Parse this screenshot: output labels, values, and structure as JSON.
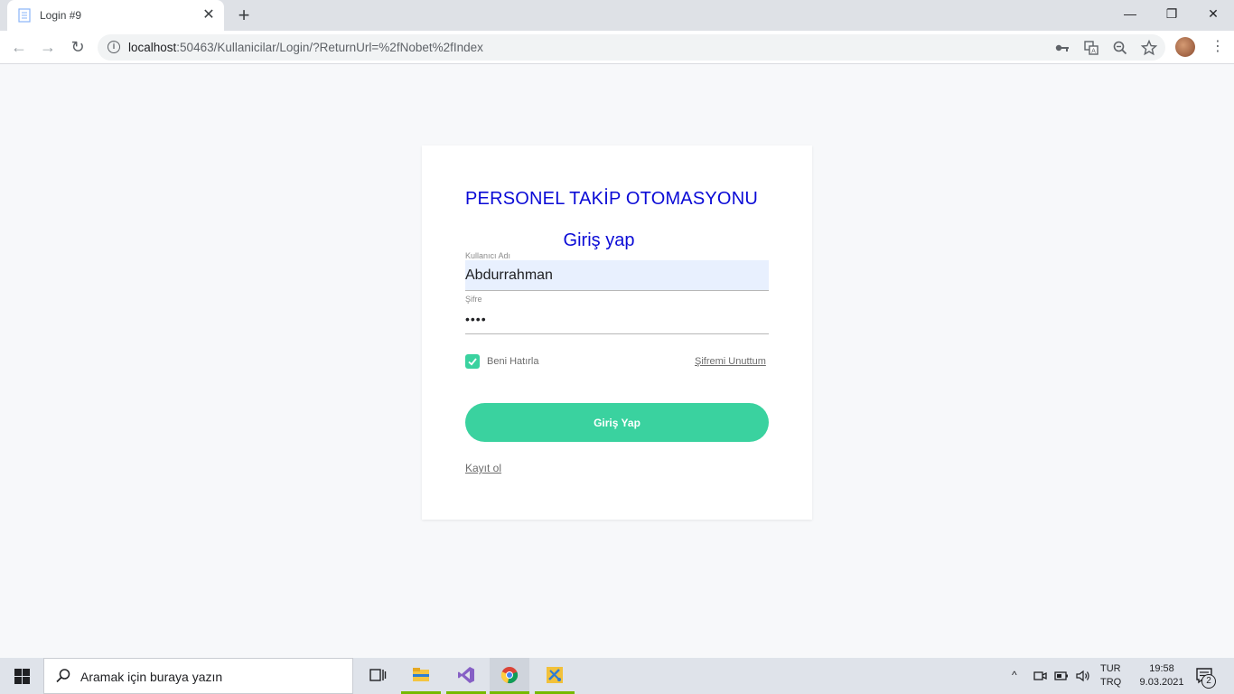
{
  "browser": {
    "tab_title": "Login #9",
    "tab_close": "✕",
    "new_tab": "+",
    "url_host": "localhost",
    "url_rest": ":50463/Kullanicilar/Login/?ReturnUrl=%2fNobet%2fIndex",
    "window_controls": {
      "minimize": "—",
      "maximize": "❐",
      "close": "✕"
    },
    "icons": [
      "back-icon",
      "forward-icon",
      "reload-icon",
      "info-icon",
      "key-icon",
      "translate-icon",
      "zoom-icon",
      "star-icon",
      "profile-avatar",
      "menu-icon"
    ]
  },
  "page": {
    "app_title": "PERSONEL TAKİP OTOMASYONU",
    "login_title": "Giriş yap",
    "username": {
      "label": "Kullanıcı Adı",
      "value": "Abdurrahman"
    },
    "password": {
      "label": "Şifre",
      "value": "••••"
    },
    "remember": {
      "label": "Beni Hatırla",
      "checked": true
    },
    "forgot_label": "Şifremi Unuttum",
    "submit_label": "Giriş Yap",
    "register_label": "Kayıt ol"
  },
  "colors": {
    "title_blue": "#0a0ad6",
    "accent_green": "#3ad29f",
    "page_bg": "#f7f8fa",
    "autofill_bg": "#e8f0fe"
  },
  "taskbar": {
    "search_placeholder": "Aramak için buraya yazın",
    "apps": [
      "task-view-icon",
      "file-explorer-icon",
      "visual-studio-icon",
      "chrome-icon",
      "tool-icon"
    ],
    "tray_chevron": "^",
    "lang_top": "TUR",
    "lang_bottom": "TRQ",
    "time": "19:58",
    "date": "9.03.2021",
    "notification_count": "2"
  }
}
